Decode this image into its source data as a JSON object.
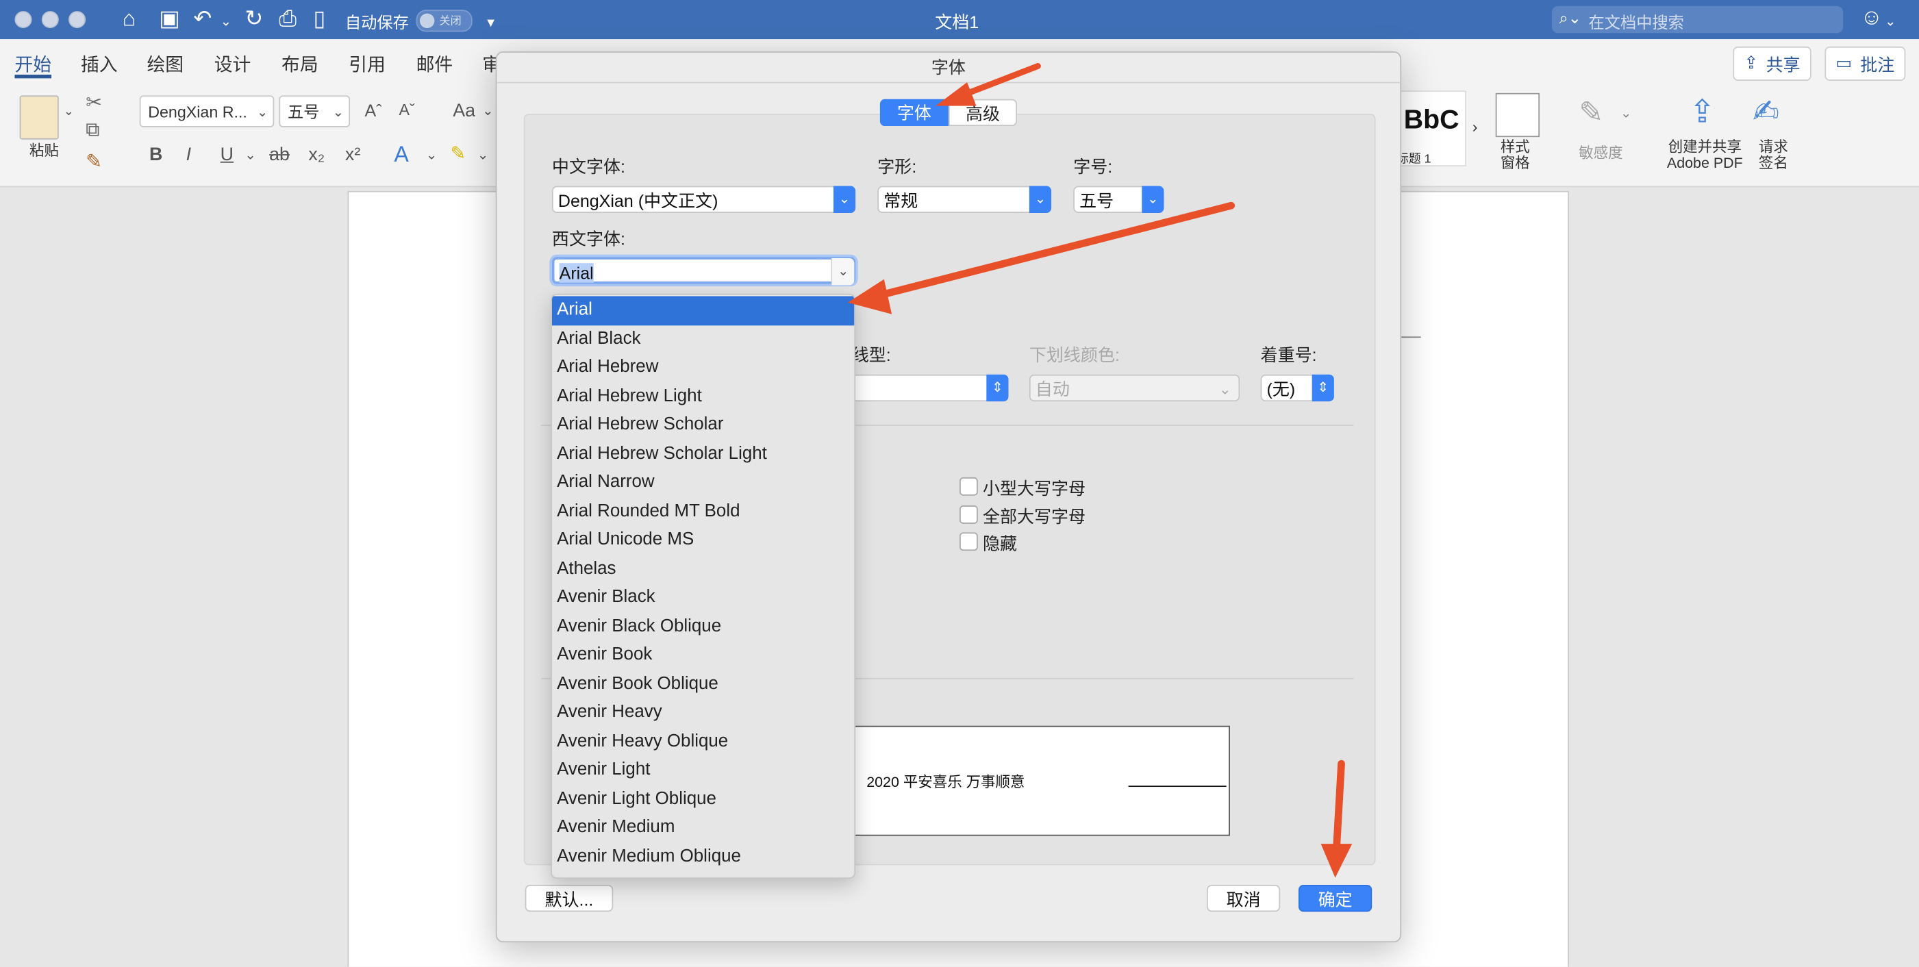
{
  "window": {
    "title": "文档1",
    "autosave_label": "自动保存",
    "autosave_state": "关闭",
    "search_placeholder": "在文档中搜索"
  },
  "ribbon_tabs": [
    "开始",
    "插入",
    "绘图",
    "设计",
    "布局",
    "引用",
    "邮件",
    "审"
  ],
  "ribbon_right": {
    "share": "共享",
    "comment": "批注"
  },
  "ribbon": {
    "paste_label": "粘贴",
    "font_name": "DengXian R...",
    "font_size": "五号",
    "style_preview": "BbC",
    "style_name": "标题 1",
    "style_pane": [
      "样式",
      "窗格"
    ],
    "sensitivity": "敏感度",
    "create_share": [
      "创建并共享",
      "Adobe PDF"
    ],
    "request_sign": [
      "请求",
      "签名"
    ]
  },
  "dialog": {
    "title": "字体",
    "tabs": [
      "字体",
      "高级"
    ],
    "chinese_font_label": "中文字体:",
    "chinese_font_value": "DengXian (中文正文)",
    "style_label": "字形:",
    "style_value": "常规",
    "size_label": "字号:",
    "size_value": "五号",
    "western_font_label": "西文字体:",
    "western_font_value": "Arial",
    "underline_type_label": "线型:",
    "underline_color_label": "下划线颜色:",
    "underline_color_value": "自动",
    "emphasis_label": "着重号:",
    "emphasis_value": "(无)",
    "checkboxes": [
      "小型大写字母",
      "全部大写字母",
      "隐藏"
    ],
    "preview_text": "2020 平安喜乐 万事顺意",
    "default_button": "默认...",
    "cancel_button": "取消",
    "ok_button": "确定"
  },
  "font_list": {
    "selected": "Arial",
    "items": [
      "Arial",
      "Arial Black",
      "Arial Hebrew",
      "Arial Hebrew Light",
      "Arial Hebrew Scholar",
      "Arial Hebrew Scholar Light",
      "Arial Narrow",
      "Arial Rounded MT Bold",
      "Arial Unicode MS",
      "Athelas",
      "Avenir Black",
      "Avenir Black Oblique",
      "Avenir Book",
      "Avenir Book Oblique",
      "Avenir Heavy",
      "Avenir Heavy Oblique",
      "Avenir Light",
      "Avenir Light Oblique",
      "Avenir Medium",
      "Avenir Medium Oblique"
    ]
  },
  "colors": {
    "accent": "#3a82f7",
    "titlebar": "#3e6fb6",
    "annotation_arrow": "#e8502a"
  }
}
